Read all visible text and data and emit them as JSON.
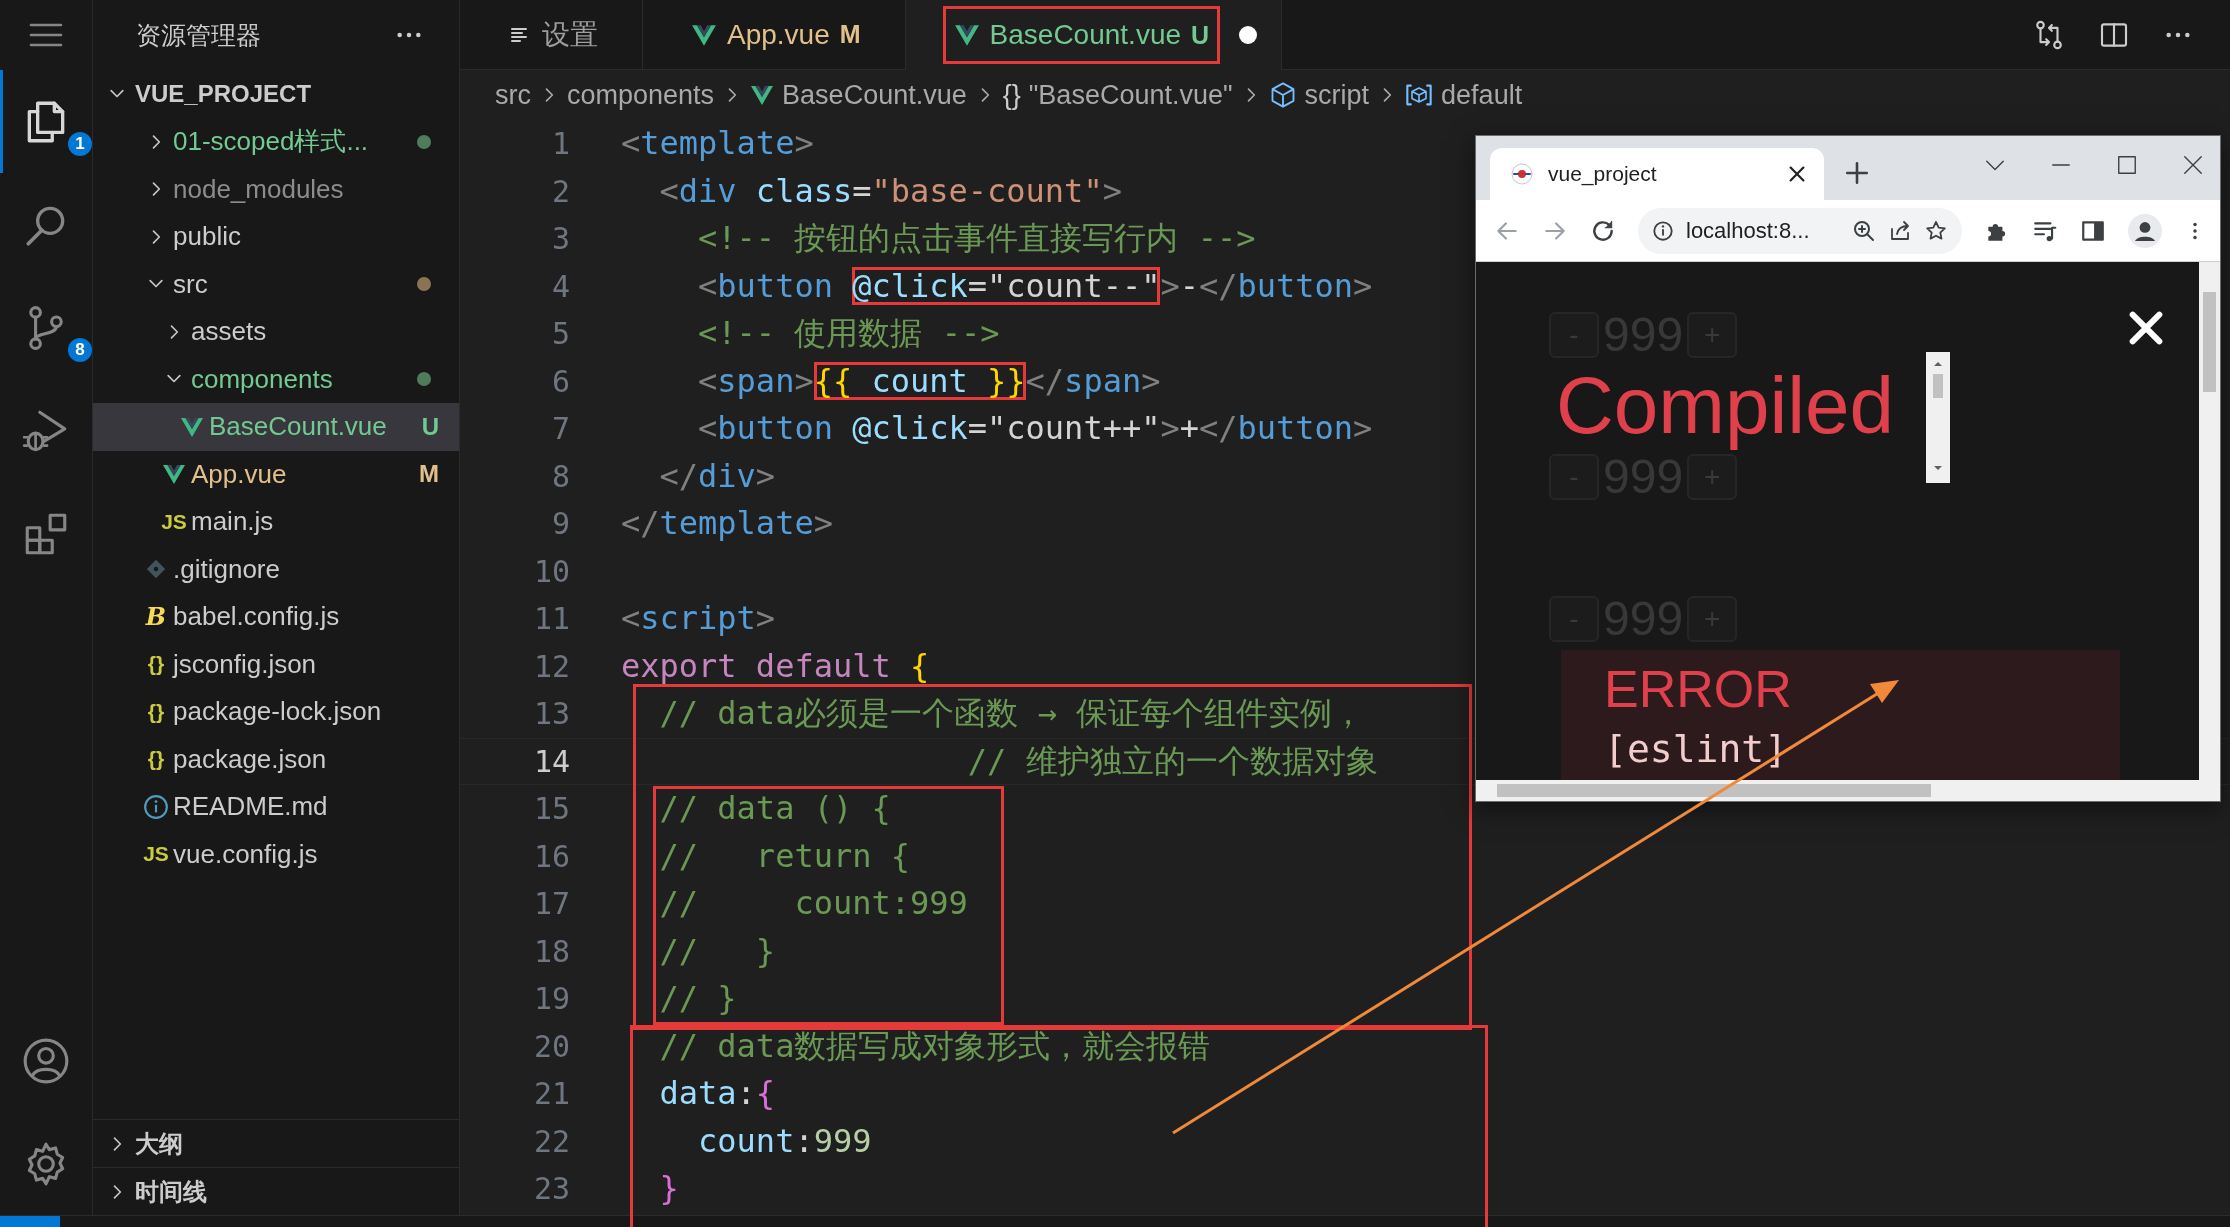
{
  "activity_bar": {
    "items": [
      {
        "kind": "explorer",
        "badge": "1",
        "selected": true
      },
      {
        "kind": "search",
        "selected": false
      },
      {
        "kind": "source-control",
        "badge": "8",
        "selected": false
      },
      {
        "kind": "run-debug",
        "selected": false
      },
      {
        "kind": "extensions",
        "selected": false
      }
    ],
    "bottom_items": [
      {
        "kind": "account"
      },
      {
        "kind": "settings"
      }
    ]
  },
  "sidebar": {
    "title": "资源管理器",
    "project": {
      "name": "VUE_PROJECT",
      "expanded": true
    },
    "tree": [
      {
        "name": "01-scoped样式...",
        "kind": "folder",
        "expanded": false,
        "color": "#73c991",
        "dot": {
          "color": "#4f7d5c"
        },
        "selected": false
      },
      {
        "name": "node_modules",
        "kind": "folder",
        "expanded": false,
        "color": "#8c8c8c",
        "selected": false
      },
      {
        "name": "public",
        "kind": "folder",
        "expanded": false,
        "selected": false
      },
      {
        "name": "src",
        "kind": "folder",
        "expanded": true,
        "dot": {
          "color": "#8b7355"
        },
        "selected": false,
        "children": [
          {
            "name": "assets",
            "kind": "folder",
            "expanded": false,
            "selected": false
          },
          {
            "name": "components",
            "kind": "folder",
            "expanded": true,
            "color": "#73c991",
            "dot": {
              "color": "#4f7d5c"
            },
            "selected": false,
            "children": [
              {
                "name": "BaseCount.vue",
                "kind": "vue",
                "color": "#73c991",
                "badge": "U",
                "selected": true
              }
            ]
          },
          {
            "name": "App.vue",
            "kind": "vue",
            "color": "#e2c08d",
            "badge": "M",
            "selected": false
          },
          {
            "name": "main.js",
            "kind": "js",
            "icon_text": "JS",
            "selected": false
          }
        ]
      },
      {
        "name": ".gitignore",
        "kind": "git",
        "selected": false
      },
      {
        "name": "babel.config.js",
        "kind": "babel",
        "icon_text": "B",
        "selected": false
      },
      {
        "name": "jsconfig.json",
        "kind": "json",
        "icon_text": "{}",
        "selected": false
      },
      {
        "name": "package-lock.json",
        "kind": "json",
        "icon_text": "{}",
        "selected": false
      },
      {
        "name": "package.json",
        "kind": "json",
        "icon_text": "{}",
        "selected": false
      },
      {
        "name": "README.md",
        "kind": "info",
        "selected": false
      },
      {
        "name": "vue.config.js",
        "kind": "js",
        "icon_text": "JS",
        "selected": false
      }
    ],
    "sections": [
      {
        "title": "大纲",
        "expanded": false
      },
      {
        "title": "时间线",
        "expanded": false
      }
    ]
  },
  "editor": {
    "tabs": [
      {
        "label": "设置",
        "kind": "settings",
        "selected": false,
        "dirty": false,
        "highlighted": false
      },
      {
        "label": "App.vue",
        "kind": "vue",
        "badge": "M",
        "color": "#e2c08d",
        "selected": false,
        "dirty": false,
        "highlighted": false
      },
      {
        "label": "BaseCount.vue",
        "kind": "vue",
        "badge": "U",
        "color": "#73c991",
        "selected": true,
        "dirty": true,
        "highlighted": true
      }
    ],
    "breadcrumb": [
      {
        "label": "src",
        "kind": "folder"
      },
      {
        "label": "components",
        "kind": "folder"
      },
      {
        "label": "BaseCount.vue",
        "kind": "vue"
      },
      {
        "label": "\"BaseCount.vue\"",
        "kind": "braces",
        "icon_text": "{}"
      },
      {
        "label": "script",
        "kind": "cube"
      },
      {
        "label": "default",
        "kind": "variable"
      }
    ],
    "lines": [
      {
        "number": "1",
        "current": false,
        "tokens": [
          {
            "text": "<",
            "kind": "punct"
          },
          {
            "text": "template",
            "kind": "tag"
          },
          {
            "text": ">",
            "kind": "punct"
          }
        ]
      },
      {
        "number": "2",
        "current": false,
        "tokens": [
          {
            "text": "  <",
            "kind": "punct"
          },
          {
            "text": "div",
            "kind": "tag"
          },
          {
            "text": " class",
            "kind": "attr"
          },
          {
            "text": "=",
            "kind": "plain"
          },
          {
            "text": "\"base-count\"",
            "kind": "string"
          },
          {
            "text": ">",
            "kind": "punct"
          }
        ]
      },
      {
        "number": "3",
        "current": false,
        "tokens": [
          {
            "text": "    <!-- 按钮的点击事件直接写行内 -->",
            "kind": "comment"
          }
        ]
      },
      {
        "number": "4",
        "current": false,
        "tokens": [
          {
            "text": "    <",
            "kind": "punct",
            "boxed": false
          },
          {
            "text": "button ",
            "kind": "tag",
            "boxed": false
          },
          {
            "text": "@click",
            "kind": "attr",
            "boxed": true
          },
          {
            "text": "=",
            "kind": "plain",
            "boxed": true
          },
          {
            "text": "\"count--\"",
            "kind": "string-light",
            "boxed": true
          },
          {
            "text": ">",
            "kind": "punct",
            "boxed": false
          },
          {
            "text": "-",
            "kind": "plain",
            "boxed": false
          },
          {
            "text": "</",
            "kind": "punct",
            "boxed": false
          },
          {
            "text": "button",
            "kind": "tag",
            "boxed": false
          },
          {
            "text": ">",
            "kind": "punct",
            "boxed": false
          }
        ]
      },
      {
        "number": "5",
        "current": false,
        "tokens": [
          {
            "text": "    <!-- 使用数据 -->",
            "kind": "comment"
          }
        ]
      },
      {
        "number": "6",
        "current": false,
        "tokens": [
          {
            "text": "    <",
            "kind": "punct",
            "boxed": false
          },
          {
            "text": "span",
            "kind": "tag",
            "boxed": false
          },
          {
            "text": ">",
            "kind": "punct",
            "boxed": false
          },
          {
            "text": "{{",
            "kind": "brace",
            "boxed": true
          },
          {
            "text": " count ",
            "kind": "attr",
            "boxed": true
          },
          {
            "text": "}}",
            "kind": "brace",
            "boxed": true
          },
          {
            "text": "</",
            "kind": "punct",
            "boxed": false
          },
          {
            "text": "span",
            "kind": "tag",
            "boxed": false
          },
          {
            "text": ">",
            "kind": "punct",
            "boxed": false
          }
        ]
      },
      {
        "number": "7",
        "current": false,
        "tokens": [
          {
            "text": "    <",
            "kind": "punct"
          },
          {
            "text": "button",
            "kind": "tag"
          },
          {
            "text": " @click",
            "kind": "attr"
          },
          {
            "text": "=",
            "kind": "plain"
          },
          {
            "text": "\"count++\"",
            "kind": "string-light"
          },
          {
            "text": ">",
            "kind": "punct"
          },
          {
            "text": "+",
            "kind": "plain"
          },
          {
            "text": "</",
            "kind": "punct"
          },
          {
            "text": "button",
            "kind": "tag"
          },
          {
            "text": ">",
            "kind": "punct"
          }
        ]
      },
      {
        "number": "8",
        "current": false,
        "tokens": [
          {
            "text": "  </",
            "kind": "punct"
          },
          {
            "text": "div",
            "kind": "tag"
          },
          {
            "text": ">",
            "kind": "punct"
          }
        ]
      },
      {
        "number": "9",
        "current": false,
        "tokens": [
          {
            "text": "</",
            "kind": "punct"
          },
          {
            "text": "template",
            "kind": "tag"
          },
          {
            "text": ">",
            "kind": "punct"
          }
        ]
      },
      {
        "number": "10",
        "current": false
      },
      {
        "number": "11",
        "current": false,
        "tokens": [
          {
            "text": "<",
            "kind": "punct"
          },
          {
            "text": "script",
            "kind": "tag"
          },
          {
            "text": ">",
            "kind": "punct"
          }
        ]
      },
      {
        "number": "12",
        "current": false,
        "tokens": [
          {
            "text": "export default ",
            "kind": "keyword"
          },
          {
            "text": "{",
            "kind": "brace"
          }
        ]
      },
      {
        "number": "13",
        "current": false,
        "tokens": [
          {
            "text": "  // data必须是一个函数 → 保证每个组件实例，",
            "kind": "comment"
          }
        ]
      },
      {
        "number": "14",
        "current": true,
        "tokens": [
          {
            "text": "                  // 维护独立的一个数据对象",
            "kind": "comment"
          }
        ]
      },
      {
        "number": "15",
        "current": false,
        "tokens": [
          {
            "text": "  // data () {",
            "kind": "comment"
          }
        ]
      },
      {
        "number": "16",
        "current": false,
        "tokens": [
          {
            "text": "  //   return {",
            "kind": "comment"
          }
        ]
      },
      {
        "number": "17",
        "current": false,
        "tokens": [
          {
            "text": "  //     count:999",
            "kind": "comment"
          }
        ]
      },
      {
        "number": "18",
        "current": false,
        "tokens": [
          {
            "text": "  //   }",
            "kind": "comment"
          }
        ]
      },
      {
        "number": "19",
        "current": false,
        "tokens": [
          {
            "text": "  // }",
            "kind": "comment"
          }
        ]
      },
      {
        "number": "20",
        "current": false,
        "tokens": [
          {
            "text": "  // data数据写成对象形式，就会报错",
            "kind": "comment"
          }
        ]
      },
      {
        "number": "21",
        "current": false,
        "tokens": [
          {
            "text": "  data",
            "kind": "attr"
          },
          {
            "text": ":",
            "kind": "plain"
          },
          {
            "text": "{",
            "kind": "brace2"
          }
        ]
      },
      {
        "number": "22",
        "current": false,
        "tokens": [
          {
            "text": "    count",
            "kind": "attr"
          },
          {
            "text": ":",
            "kind": "plain"
          },
          {
            "text": "999",
            "kind": "number"
          }
        ]
      },
      {
        "number": "23",
        "current": false,
        "tokens": [
          {
            "text": "  }",
            "kind": "brace2"
          }
        ]
      }
    ]
  },
  "browser": {
    "tab_title": "vue_project",
    "address": "localhost:8...",
    "counters": [
      {
        "minus": "-",
        "value": "999",
        "plus": "+"
      },
      {
        "minus": "-",
        "value": "999",
        "plus": "+"
      },
      {
        "minus": "-",
        "value": "999",
        "plus": "+"
      }
    ],
    "overlay": {
      "title": "Compiled",
      "error_label": "ERROR",
      "error_detail": "[eslint]"
    }
  }
}
